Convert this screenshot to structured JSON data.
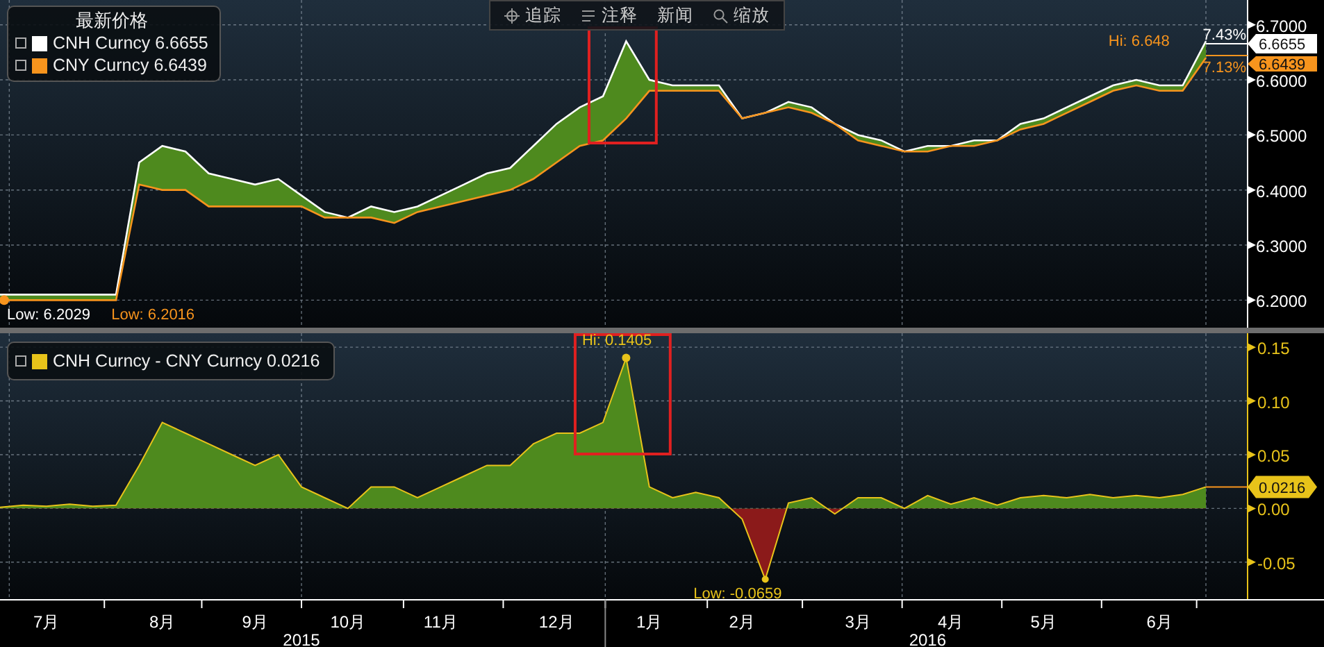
{
  "toolbar": [
    {
      "kind": "crosshair",
      "label": "追踪"
    },
    {
      "kind": "note",
      "label": "注释"
    },
    {
      "kind": "plain",
      "label": "新闻"
    },
    {
      "kind": "zoom",
      "label": "缩放"
    }
  ],
  "price_chart": {
    "legend": {
      "title": "最新价格",
      "values": [
        "6.6655",
        "6.6439"
      ]
    },
    "axis_tags": [
      "6.6655",
      "6.6439"
    ],
    "highlight_box": true,
    "chart_data": {
      "type": "area",
      "grid": true,
      "categories": [
        null,
        null,
        null,
        null,
        null,
        null,
        null,
        null,
        null,
        null,
        null,
        null,
        null,
        null,
        null,
        null,
        null,
        null,
        null,
        null,
        null,
        null,
        null,
        null,
        null,
        null,
        null,
        null,
        null,
        null,
        null,
        null,
        null,
        null,
        null,
        null,
        null,
        null,
        null,
        null,
        null,
        null,
        null,
        null,
        null,
        null,
        null,
        null,
        null,
        null,
        null,
        null,
        null
      ],
      "series": [
        {
          "name": "CNH Curncy",
          "color": "#ffffff",
          "type": "area",
          "values": [
            6.21,
            6.21,
            6.21,
            6.21,
            6.21,
            6.21,
            6.45,
            6.48,
            6.47,
            6.43,
            6.42,
            6.41,
            6.42,
            6.39,
            6.36,
            6.35,
            6.37,
            6.36,
            6.37,
            6.39,
            6.41,
            6.43,
            6.44,
            6.48,
            6.52,
            6.55,
            6.57,
            6.67,
            6.6,
            6.59,
            6.59,
            6.59,
            6.53,
            6.54,
            6.56,
            6.55,
            6.52,
            6.5,
            6.49,
            6.47,
            6.48,
            6.48,
            6.49,
            6.49,
            6.52,
            6.53,
            6.55,
            6.57,
            6.59,
            6.6,
            6.59,
            6.59,
            6.67
          ]
        },
        {
          "name": "CNY Curncy",
          "color": "#f7941d",
          "type": "line",
          "values": [
            6.2,
            6.2,
            6.2,
            6.2,
            6.2,
            6.2,
            6.41,
            6.4,
            6.4,
            6.37,
            6.37,
            6.37,
            6.37,
            6.37,
            6.35,
            6.35,
            6.35,
            6.34,
            6.36,
            6.37,
            6.38,
            6.39,
            6.4,
            6.42,
            6.45,
            6.48,
            6.49,
            6.53,
            6.58,
            6.58,
            6.58,
            6.58,
            6.53,
            6.54,
            6.55,
            6.54,
            6.52,
            6.49,
            6.48,
            6.47,
            6.47,
            6.48,
            6.48,
            6.49,
            6.51,
            6.52,
            6.54,
            6.56,
            6.58,
            6.59,
            6.58,
            6.58,
            6.64
          ]
        }
      ],
      "ylim": [
        6.15,
        6.745
      ],
      "yticks": [
        {
          "value": 6.7,
          "label": "6.7000"
        },
        {
          "value": 6.6,
          "label": "6.6000"
        },
        {
          "value": 6.5,
          "label": "6.5000"
        },
        {
          "value": 6.4,
          "label": "6.4000"
        },
        {
          "value": 6.3,
          "label": "6.3000"
        },
        {
          "value": 6.2,
          "label": "6.2000"
        }
      ],
      "annotations": [
        "Low: 6.2029",
        "Low: 6.2016",
        "Hi: 6.648",
        "7.43%",
        "7.13%"
      ]
    }
  },
  "spread_chart": {
    "legend": {
      "values": [
        "0.0216"
      ]
    },
    "axis_tags": [
      "0.0216"
    ],
    "highlight_box": true,
    "x_axis_years": [
      "2015",
      "2016"
    ],
    "chart_data": {
      "type": "area",
      "grid": true,
      "categories": [
        null,
        null,
        "7月",
        null,
        null,
        null,
        null,
        "8月",
        null,
        null,
        null,
        "9月",
        null,
        null,
        null,
        "10月",
        null,
        null,
        null,
        "11月",
        null,
        null,
        null,
        null,
        "12月",
        null,
        null,
        null,
        "1月",
        null,
        null,
        null,
        "2月",
        null,
        null,
        null,
        null,
        "3月",
        null,
        null,
        null,
        "4月",
        null,
        null,
        null,
        "5月",
        null,
        null,
        null,
        null,
        "6月",
        null,
        null
      ],
      "series": [
        {
          "name": "CNH Curncy - CNY Curncy",
          "color": "#e8c31a",
          "values": [
            0.001,
            0.003,
            0.002,
            0.004,
            0.002,
            0.003,
            0.04,
            0.08,
            0.07,
            0.06,
            0.05,
            0.04,
            0.05,
            0.02,
            0.01,
            0.0,
            0.02,
            0.02,
            0.01,
            0.02,
            0.03,
            0.04,
            0.04,
            0.06,
            0.07,
            0.07,
            0.08,
            0.14,
            0.02,
            0.01,
            0.015,
            0.01,
            -0.01,
            -0.066,
            0.005,
            0.01,
            -0.005,
            0.01,
            0.01,
            0.0,
            0.012,
            0.004,
            0.01,
            0.003,
            0.01,
            0.012,
            0.01,
            0.013,
            0.01,
            0.012,
            0.01,
            0.013,
            0.02
          ]
        }
      ],
      "ylim": [
        -0.085,
        0.163
      ],
      "yticks": [
        {
          "value": 0.15,
          "label": "0.15"
        },
        {
          "value": 0.1,
          "label": "0.10"
        },
        {
          "value": 0.05,
          "label": "0.05"
        },
        {
          "value": 0,
          "label": "0.00"
        },
        {
          "value": -0.05,
          "label": "-0.05"
        }
      ],
      "annotations": [
        "Hi: 0.1405",
        "Low: -0.0659"
      ]
    }
  }
}
